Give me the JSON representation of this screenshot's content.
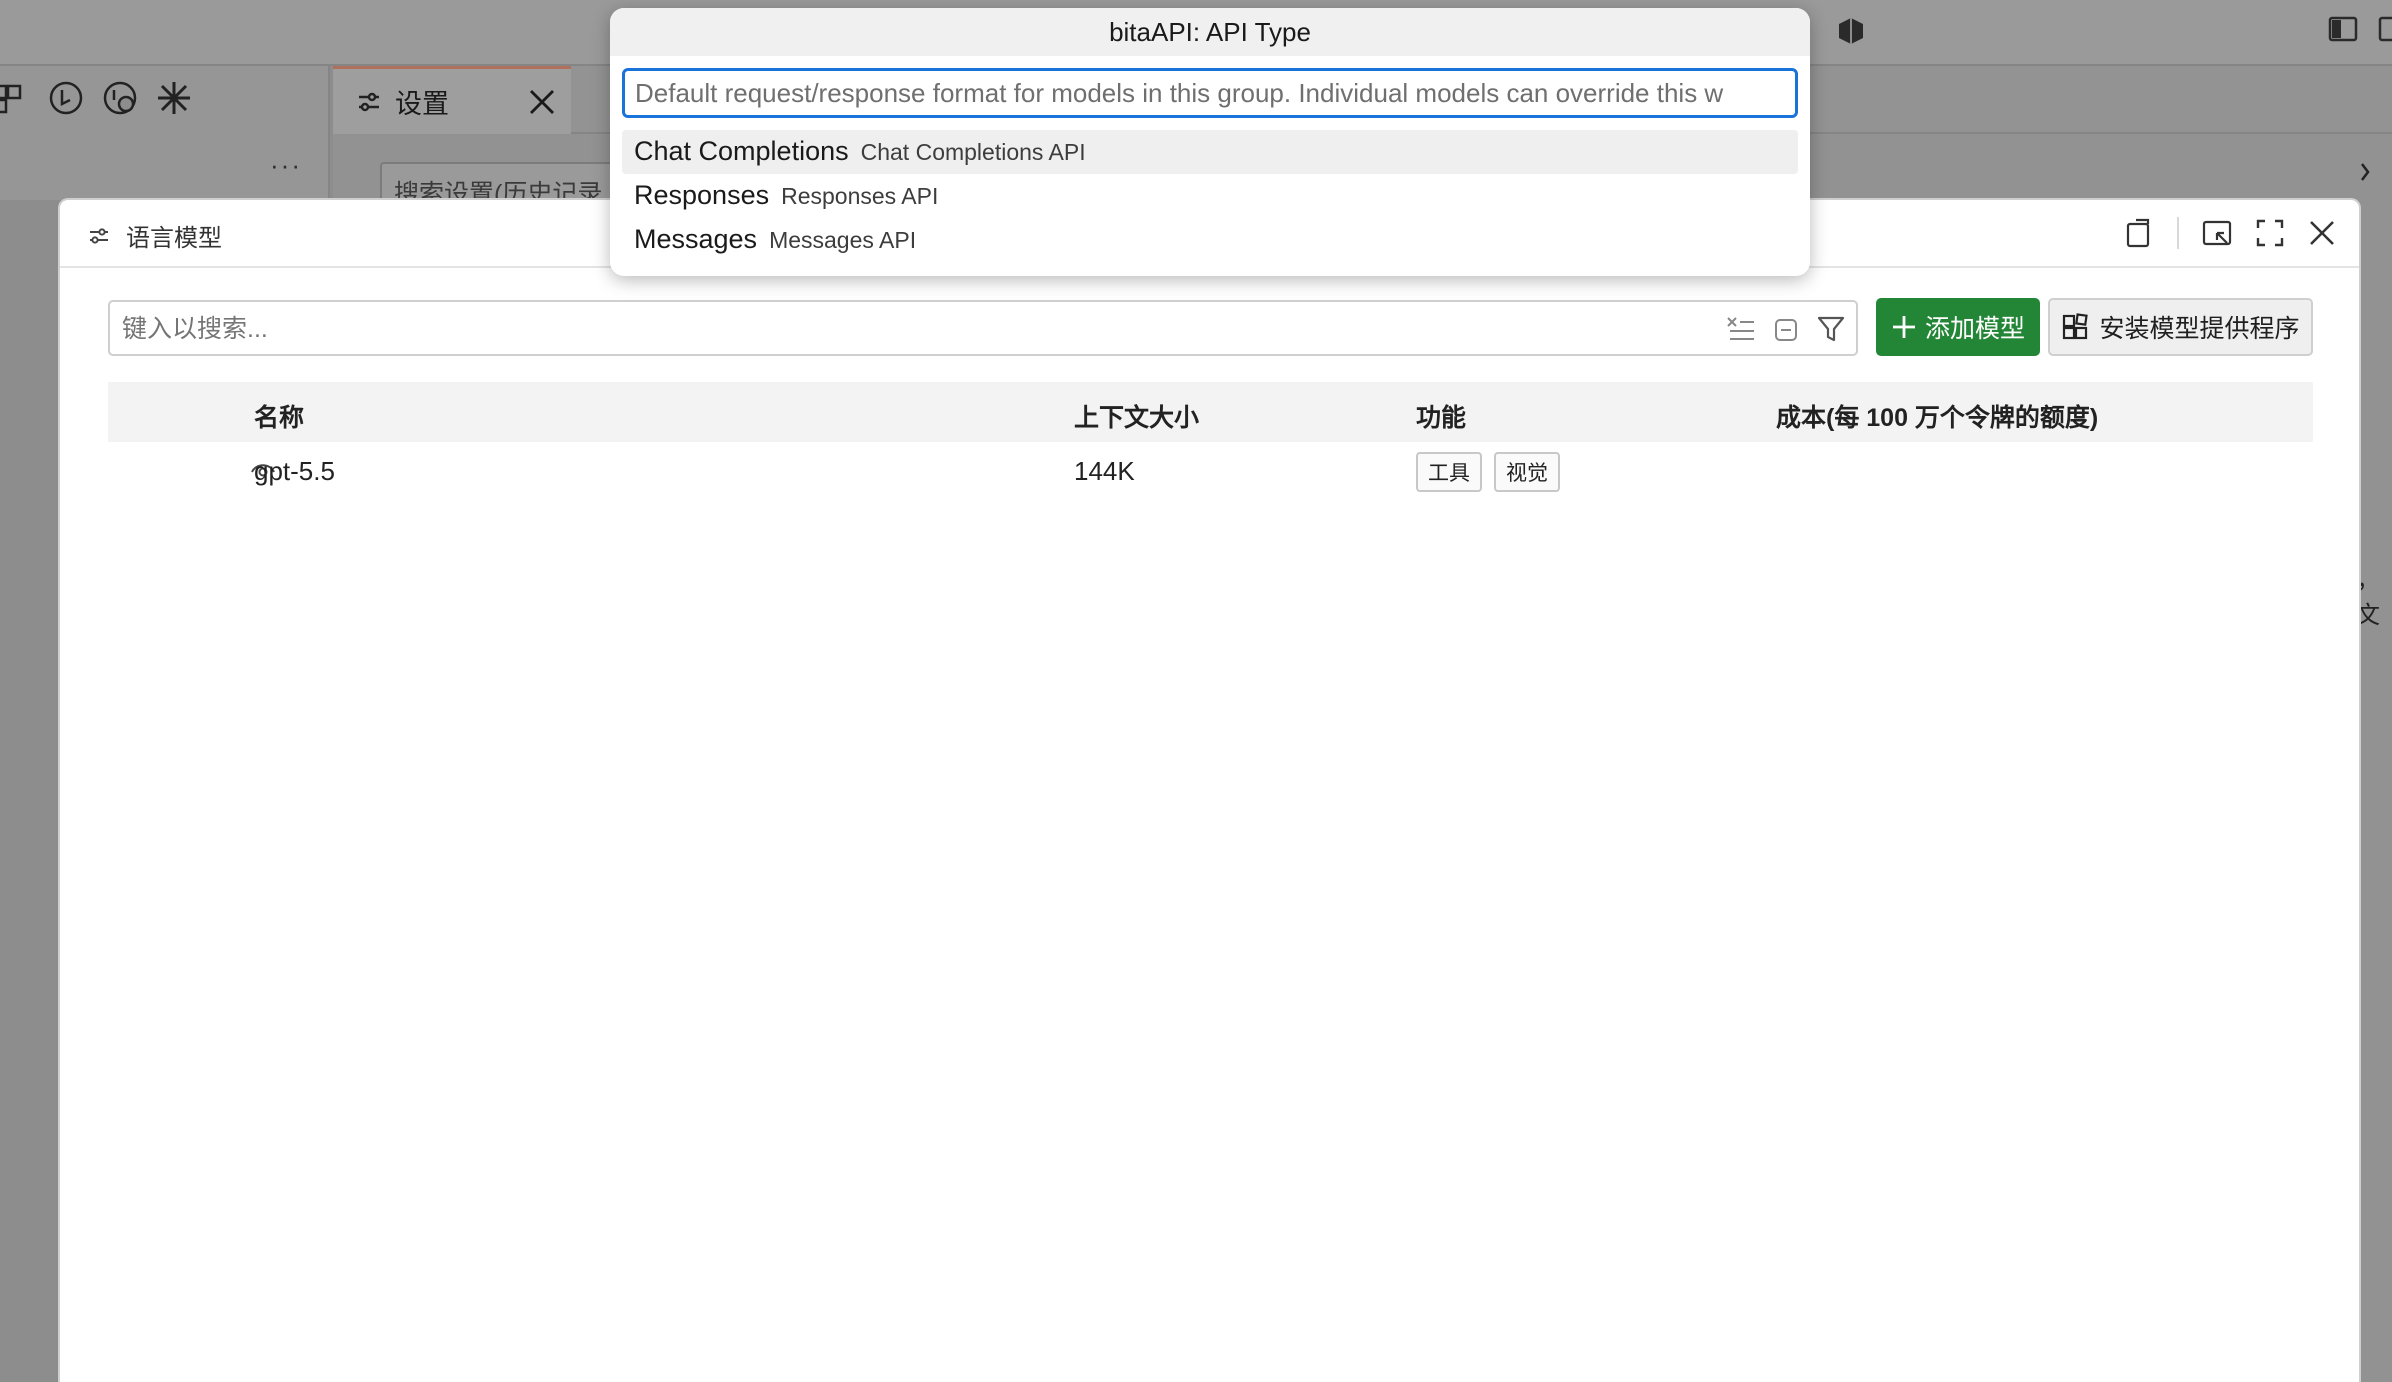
{
  "background": {
    "tab_label": "设置",
    "search_placeholder": "搜索设置(历史记录",
    "more_label": "···",
    "right_edge_text": "，文"
  },
  "panel": {
    "title": "语言模型",
    "search_placeholder": "键入以搜索...",
    "add_button": "添加模型",
    "install_button": "安装模型提供程序",
    "columns": {
      "name": "名称",
      "context": "上下文大小",
      "capabilities": "功能",
      "cost": "成本(每 100 万个令牌的额度)"
    },
    "rows": [
      {
        "name": "gpt-5.5",
        "context": "144K",
        "tags": [
          "工具",
          "视觉"
        ]
      }
    ]
  },
  "quickpick": {
    "title": "bitaAPI: API Type",
    "placeholder": "Default request/response format for models in this group. Individual models can override this w",
    "items": [
      {
        "label": "Chat Completions",
        "description": "Chat Completions API"
      },
      {
        "label": "Responses",
        "description": "Responses API"
      },
      {
        "label": "Messages",
        "description": "Messages API"
      }
    ]
  },
  "colors": {
    "primary_button": "#238636",
    "focus_border": "#1a73d9"
  }
}
